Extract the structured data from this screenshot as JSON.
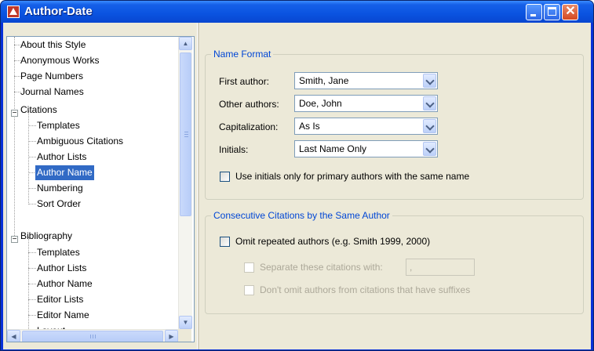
{
  "window": {
    "title": "Author-Date",
    "icon": "document-app-icon",
    "controls": {
      "minimize": "minimize-icon",
      "maximize": "maximize-icon",
      "close": "close-icon",
      "close_glyph": "✕"
    }
  },
  "tree": {
    "items": [
      {
        "label": "About this Style"
      },
      {
        "label": "Anonymous Works"
      },
      {
        "label": "Page Numbers"
      },
      {
        "label": "Journal Names"
      },
      {
        "label": "Citations",
        "expanded": true,
        "expander": "⊟"
      },
      {
        "label": "Templates"
      },
      {
        "label": "Ambiguous Citations"
      },
      {
        "label": "Author Lists"
      },
      {
        "label": "Author Name",
        "selected": true
      },
      {
        "label": "Numbering"
      },
      {
        "label": "Sort Order"
      },
      {
        "label": "Bibliography",
        "expanded": true,
        "expander": "⊟"
      },
      {
        "label": "Templates"
      },
      {
        "label": "Author Lists"
      },
      {
        "label": "Author Name"
      },
      {
        "label": "Editor Lists"
      },
      {
        "label": "Editor Name"
      },
      {
        "label": "Layout"
      }
    ],
    "scroll_glyphs": {
      "up": "▲",
      "down": "▼",
      "left": "◀",
      "right": "▶"
    }
  },
  "name_format": {
    "legend": "Name Format",
    "first_author": {
      "label": "First author:",
      "value": "Smith, Jane"
    },
    "other_authors": {
      "label": "Other authors:",
      "value": "Doe, John"
    },
    "capitalization": {
      "label": "Capitalization:",
      "value": "As Is"
    },
    "initials": {
      "label": "Initials:",
      "value": "Last Name Only"
    },
    "use_initials_checkbox": {
      "label": "Use initials only for primary authors with the same name",
      "checked": false
    }
  },
  "consecutive": {
    "legend": "Consecutive Citations by the Same Author",
    "omit_repeated": {
      "label": "Omit repeated authors (e.g. Smith 1999, 2000)",
      "checked": false
    },
    "separate": {
      "label": "Separate these citations with:",
      "value": ",",
      "enabled": false
    },
    "dont_omit": {
      "label": "Don't omit authors from citations that have suffixes",
      "enabled": false
    }
  },
  "colors": {
    "titlebar": "#0a53e0",
    "selection": "#316ac5",
    "legend": "#0046d5",
    "face": "#ece9d8"
  }
}
